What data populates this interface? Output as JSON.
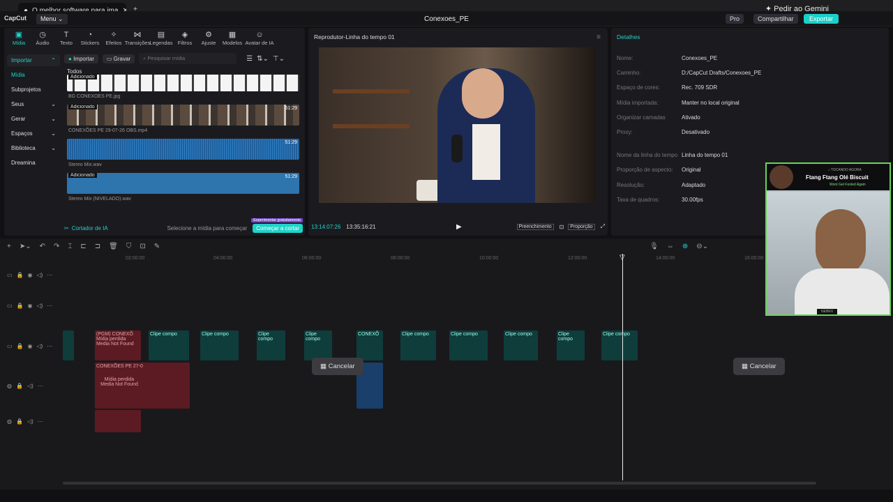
{
  "browser": {
    "tab_title": "O melhor software para ima",
    "gemini": "Pedir ao Gemini"
  },
  "app": {
    "logo": "CapCut",
    "menu": "Menu",
    "project": "Conexoes_PE",
    "pro": "Pro",
    "share": "Compartilhar",
    "export": "Exportar"
  },
  "tools": [
    "Mídia",
    "Áudio",
    "Texto",
    "Stickers",
    "Efeitos",
    "Transições",
    "Legendas",
    "Filtros",
    "Ajuste",
    "Modelos",
    "Avatar de IA"
  ],
  "nav": [
    "Importar",
    "Mídia",
    "Subprojetos",
    "Seus",
    "Gerar",
    "Espaços",
    "Biblioteca",
    "Dreamina"
  ],
  "media": {
    "import": "Importar",
    "record": "Gravar",
    "search_placeholder": "Pesquisar mídia",
    "all": "Todos",
    "added": "Adicionado",
    "clips": [
      {
        "name": "BG CONEXOES PE.jpg",
        "dur": ""
      },
      {
        "name": "CONEXÕES PE 29-07-26 OBS.mp4",
        "dur": "51:29"
      },
      {
        "name": "Stereo Mix.wav",
        "dur": "51:29"
      },
      {
        "name": "Stereo Mix (NIVELADO).wav",
        "dur": "51:29"
      }
    ]
  },
  "ai": {
    "label": "Cortador de IA",
    "hint": "Selecione a mídia para começar",
    "cta": "Começar a cortar",
    "free": "Experimentar gratuitamente"
  },
  "player": {
    "title": "Reprodutor-Linha do tempo 01",
    "current": "13:14:07:26",
    "total": "13:35:16:21",
    "fill": "Preenchimento",
    "ratio": "Proporção"
  },
  "details": {
    "title": "Detalhes",
    "rows": [
      [
        "Nome:",
        "Conexoes_PE"
      ],
      [
        "Caminho:",
        "D:/CapCut Drafts/Conexoes_PE"
      ],
      [
        "Espaço de cores:",
        "Rec. 709 SDR"
      ],
      [
        "Mídia importada:",
        "Manter no local original"
      ],
      [
        "Organizar camadas",
        "Ativado"
      ],
      [
        "Proxy:",
        "Desativado"
      ],
      [
        "Nome da linha do tempo",
        "Linha do tempo 01"
      ],
      [
        "Proporção de aspecto:",
        "Original"
      ],
      [
        "Resolução:",
        "Adaptado"
      ],
      [
        "Taxa de quadros:",
        "30.00fps"
      ]
    ]
  },
  "timeline": {
    "ruler": [
      "02:00:00",
      "04:00:00",
      "06:00:00",
      "08:00:00",
      "10:00:00",
      "12:00:00",
      "14:00:00",
      "16:00:00"
    ],
    "clip_label": "Clipe compo",
    "pgm": "(PGM) CONEXÕ",
    "lost": "Mídia perdida",
    "not_found": "Media Not Found",
    "conexoes27": "CONEXÕES PE 27-0",
    "conexo": "CONEXÕ",
    "cancel": "Cancelar"
  },
  "webcam": {
    "tag": "♪ TOCANDO AGORA",
    "title": "Ftang Ftang Olé Biscuit",
    "sub": "Wont Get Fooled Again",
    "badge": "NEBRX"
  }
}
